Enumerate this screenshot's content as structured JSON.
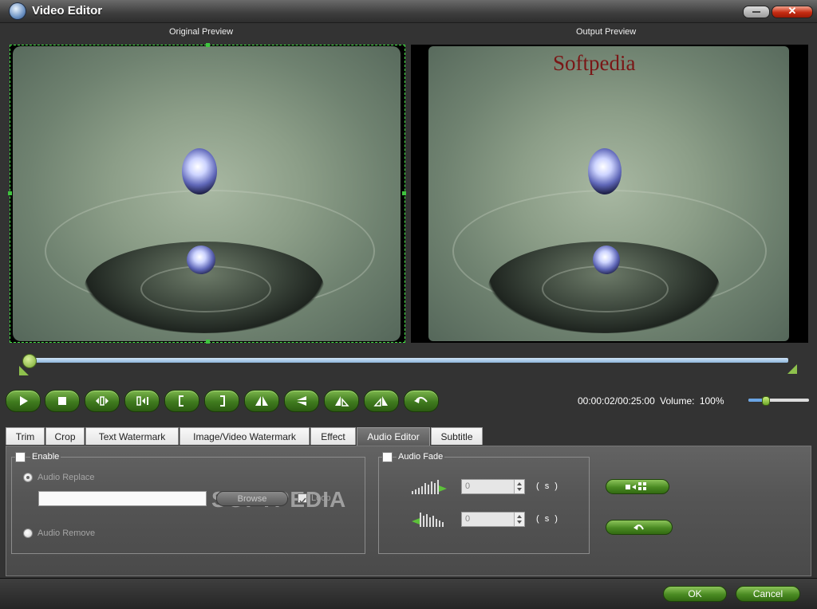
{
  "window": {
    "title": "Video Editor",
    "icon": "app-logo-icon"
  },
  "previews": {
    "original_label": "Original Preview",
    "output_label": "Output Preview",
    "watermark_text": "Softpedia"
  },
  "timeline": {
    "position_fraction": 0.0
  },
  "controls": {
    "buttons": [
      "play-icon",
      "stop-icon",
      "mark-in-point-icon",
      "mark-out-point-icon",
      "trim-start-icon",
      "trim-end-icon",
      "flip-vertical-icon",
      "flip-horizontal-icon",
      "rotate-left-icon",
      "rotate-right-icon",
      "undo-icon"
    ],
    "time": "00:00:02/00:25:00",
    "volume_label": "Volume:",
    "volume_value": "100%",
    "volume_level": 1.0
  },
  "tabs": [
    {
      "label": "Trim"
    },
    {
      "label": "Crop"
    },
    {
      "label": "Text Watermark"
    },
    {
      "label": "Image/Video Watermark"
    },
    {
      "label": "Effect"
    },
    {
      "label": "Audio Editor",
      "active": true
    },
    {
      "label": "Subtitle"
    }
  ],
  "audio_editor": {
    "enable_label": "Enable",
    "enable_checked": false,
    "replace_label": "Audio Replace",
    "replace_selected": true,
    "path_value": "",
    "browse_label": "Browse",
    "loop_label": "Loop",
    "loop_checked": true,
    "remove_label": "Audio Remove",
    "fade_label": "Audio Fade",
    "fade_checked": false,
    "fade_in_value": "0",
    "fade_out_value": "0",
    "unit": "( s )",
    "watermark_overlay": "SOFTPEDIA"
  },
  "footer": {
    "ok_label": "OK",
    "cancel_label": "Cancel"
  },
  "colors": {
    "accent_green": "#4a8a22",
    "timeline_blue": "#8fb6dc",
    "watermark_red": "#7a1616"
  }
}
